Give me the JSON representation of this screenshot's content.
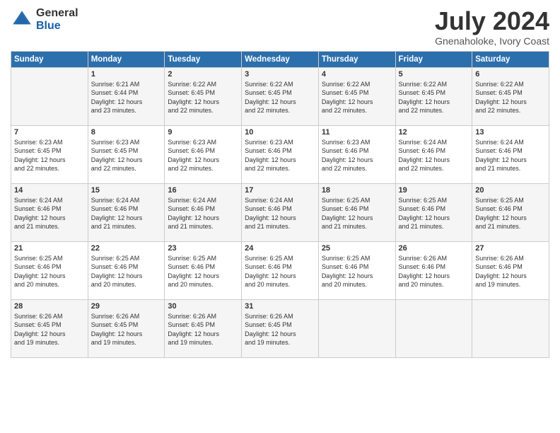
{
  "logo": {
    "general": "General",
    "blue": "Blue"
  },
  "title": "July 2024",
  "location": "Gnenaholoke, Ivory Coast",
  "days_header": [
    "Sunday",
    "Monday",
    "Tuesday",
    "Wednesday",
    "Thursday",
    "Friday",
    "Saturday"
  ],
  "weeks": [
    [
      {
        "day": "",
        "info": ""
      },
      {
        "day": "1",
        "info": "Sunrise: 6:21 AM\nSunset: 6:44 PM\nDaylight: 12 hours\nand 23 minutes."
      },
      {
        "day": "2",
        "info": "Sunrise: 6:22 AM\nSunset: 6:45 PM\nDaylight: 12 hours\nand 22 minutes."
      },
      {
        "day": "3",
        "info": "Sunrise: 6:22 AM\nSunset: 6:45 PM\nDaylight: 12 hours\nand 22 minutes."
      },
      {
        "day": "4",
        "info": "Sunrise: 6:22 AM\nSunset: 6:45 PM\nDaylight: 12 hours\nand 22 minutes."
      },
      {
        "day": "5",
        "info": "Sunrise: 6:22 AM\nSunset: 6:45 PM\nDaylight: 12 hours\nand 22 minutes."
      },
      {
        "day": "6",
        "info": "Sunrise: 6:22 AM\nSunset: 6:45 PM\nDaylight: 12 hours\nand 22 minutes."
      }
    ],
    [
      {
        "day": "7",
        "info": "Sunrise: 6:23 AM\nSunset: 6:45 PM\nDaylight: 12 hours\nand 22 minutes."
      },
      {
        "day": "8",
        "info": "Sunrise: 6:23 AM\nSunset: 6:45 PM\nDaylight: 12 hours\nand 22 minutes."
      },
      {
        "day": "9",
        "info": "Sunrise: 6:23 AM\nSunset: 6:46 PM\nDaylight: 12 hours\nand 22 minutes."
      },
      {
        "day": "10",
        "info": "Sunrise: 6:23 AM\nSunset: 6:46 PM\nDaylight: 12 hours\nand 22 minutes."
      },
      {
        "day": "11",
        "info": "Sunrise: 6:23 AM\nSunset: 6:46 PM\nDaylight: 12 hours\nand 22 minutes."
      },
      {
        "day": "12",
        "info": "Sunrise: 6:24 AM\nSunset: 6:46 PM\nDaylight: 12 hours\nand 22 minutes."
      },
      {
        "day": "13",
        "info": "Sunrise: 6:24 AM\nSunset: 6:46 PM\nDaylight: 12 hours\nand 21 minutes."
      }
    ],
    [
      {
        "day": "14",
        "info": "Sunrise: 6:24 AM\nSunset: 6:46 PM\nDaylight: 12 hours\nand 21 minutes."
      },
      {
        "day": "15",
        "info": "Sunrise: 6:24 AM\nSunset: 6:46 PM\nDaylight: 12 hours\nand 21 minutes."
      },
      {
        "day": "16",
        "info": "Sunrise: 6:24 AM\nSunset: 6:46 PM\nDaylight: 12 hours\nand 21 minutes."
      },
      {
        "day": "17",
        "info": "Sunrise: 6:24 AM\nSunset: 6:46 PM\nDaylight: 12 hours\nand 21 minutes."
      },
      {
        "day": "18",
        "info": "Sunrise: 6:25 AM\nSunset: 6:46 PM\nDaylight: 12 hours\nand 21 minutes."
      },
      {
        "day": "19",
        "info": "Sunrise: 6:25 AM\nSunset: 6:46 PM\nDaylight: 12 hours\nand 21 minutes."
      },
      {
        "day": "20",
        "info": "Sunrise: 6:25 AM\nSunset: 6:46 PM\nDaylight: 12 hours\nand 21 minutes."
      }
    ],
    [
      {
        "day": "21",
        "info": "Sunrise: 6:25 AM\nSunset: 6:46 PM\nDaylight: 12 hours\nand 20 minutes."
      },
      {
        "day": "22",
        "info": "Sunrise: 6:25 AM\nSunset: 6:46 PM\nDaylight: 12 hours\nand 20 minutes."
      },
      {
        "day": "23",
        "info": "Sunrise: 6:25 AM\nSunset: 6:46 PM\nDaylight: 12 hours\nand 20 minutes."
      },
      {
        "day": "24",
        "info": "Sunrise: 6:25 AM\nSunset: 6:46 PM\nDaylight: 12 hours\nand 20 minutes."
      },
      {
        "day": "25",
        "info": "Sunrise: 6:25 AM\nSunset: 6:46 PM\nDaylight: 12 hours\nand 20 minutes."
      },
      {
        "day": "26",
        "info": "Sunrise: 6:26 AM\nSunset: 6:46 PM\nDaylight: 12 hours\nand 20 minutes."
      },
      {
        "day": "27",
        "info": "Sunrise: 6:26 AM\nSunset: 6:46 PM\nDaylight: 12 hours\nand 19 minutes."
      }
    ],
    [
      {
        "day": "28",
        "info": "Sunrise: 6:26 AM\nSunset: 6:45 PM\nDaylight: 12 hours\nand 19 minutes."
      },
      {
        "day": "29",
        "info": "Sunrise: 6:26 AM\nSunset: 6:45 PM\nDaylight: 12 hours\nand 19 minutes."
      },
      {
        "day": "30",
        "info": "Sunrise: 6:26 AM\nSunset: 6:45 PM\nDaylight: 12 hours\nand 19 minutes."
      },
      {
        "day": "31",
        "info": "Sunrise: 6:26 AM\nSunset: 6:45 PM\nDaylight: 12 hours\nand 19 minutes."
      },
      {
        "day": "",
        "info": ""
      },
      {
        "day": "",
        "info": ""
      },
      {
        "day": "",
        "info": ""
      }
    ]
  ]
}
